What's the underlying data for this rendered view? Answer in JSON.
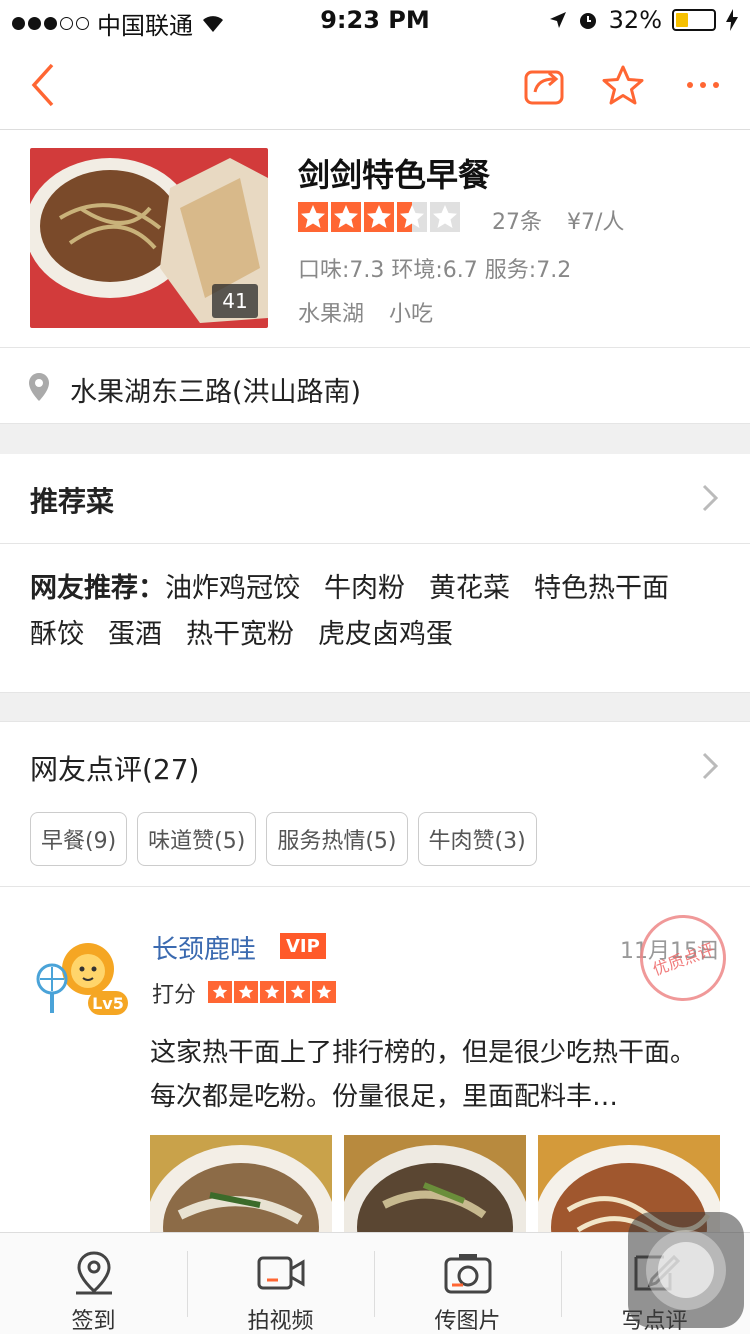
{
  "status_bar": {
    "carrier": "中国联通",
    "time": "9:23 PM",
    "battery": "32%",
    "battery_level": 0.32
  },
  "navbar": {
    "back_icon": "chevron-left-icon",
    "share_icon": "share-icon",
    "favorite_icon": "star-outline-icon",
    "more_icon": "more-icon",
    "accent_color": "#ff6633"
  },
  "shop": {
    "name": "剑剑特色早餐",
    "photo_count": "41",
    "rating": 3.5,
    "review_count": "27条",
    "price": "¥7/人",
    "scores": "口味:7.3 环境:6.7 服务:7.2",
    "tags": [
      "水果湖",
      "小吃"
    ]
  },
  "address": {
    "text": "水果湖东三路(洪山路南)"
  },
  "recommended": {
    "title": "推荐菜",
    "label": "网友推荐：",
    "dishes": [
      "油炸鸡冠饺",
      "牛肉粉",
      "黄花菜",
      "特色热干面",
      "酥饺",
      "蛋酒",
      "热干宽粉",
      "虎皮卤鸡蛋"
    ]
  },
  "reviews": {
    "title": "网友点评(27)",
    "chips": [
      "早餐(9)",
      "味道赞(5)",
      "服务热情(5)",
      "牛肉赞(3)"
    ],
    "items": [
      {
        "user": "长颈鹿哇",
        "badge": "VIP",
        "level": "Lv5",
        "date": "11月15日",
        "stamp": "优质点评",
        "score_label": "打分",
        "stars": 5,
        "text": "这家热干面上了排行榜的，但是很少吃热干面。每次都是吃粉。份量很足，里面配料丰…"
      }
    ]
  },
  "tabbar": {
    "items": [
      {
        "label": "签到",
        "icon": "location-pin-icon"
      },
      {
        "label": "拍视频",
        "icon": "video-camera-icon"
      },
      {
        "label": "传图片",
        "icon": "photo-icon"
      },
      {
        "label": "写点评",
        "icon": "edit-icon"
      }
    ]
  }
}
